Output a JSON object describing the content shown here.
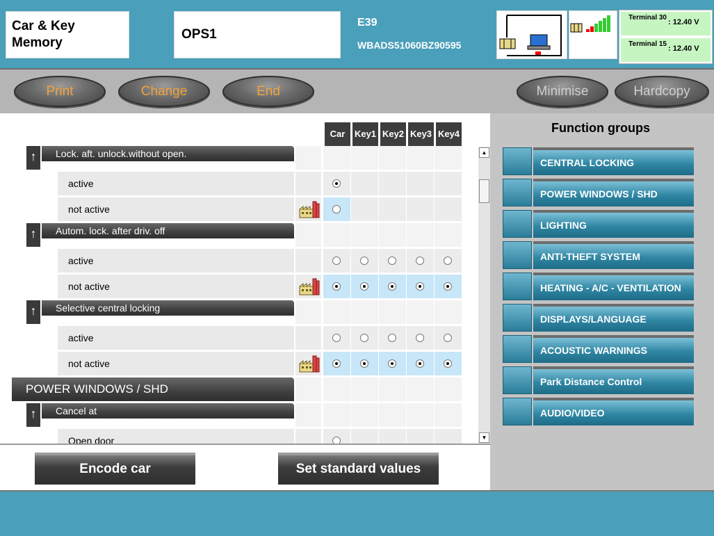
{
  "header": {
    "title": "Car & Key Memory",
    "job": "OPS1",
    "model": "E39",
    "vin": "WBADS51060BZ90595",
    "terminals": [
      {
        "label": "Terminal 30",
        "value": ": 12.40 V"
      },
      {
        "label": "Terminal 15",
        "value": ": 12.40 V"
      }
    ]
  },
  "toolbar": {
    "print": "Print",
    "change": "Change",
    "end": "End",
    "minimise": "Minimise",
    "hardcopy": "Hardcopy"
  },
  "grid": {
    "columns": [
      "Car",
      "Key1",
      "Key2",
      "Key3",
      "Key4"
    ],
    "rows": [
      {
        "type": "setting",
        "label": "Lock. aft. unlock.without open."
      },
      {
        "type": "option",
        "label": "active",
        "factory": false,
        "highlight": false,
        "radios": [
          true,
          null,
          null,
          null,
          null
        ]
      },
      {
        "type": "option",
        "label": "not active",
        "factory": true,
        "highlight": true,
        "radios": [
          false,
          null,
          null,
          null,
          null
        ]
      },
      {
        "type": "setting",
        "label": "Autom. lock. after driv. off"
      },
      {
        "type": "option",
        "label": "active",
        "factory": false,
        "highlight": false,
        "radios": [
          false,
          false,
          false,
          false,
          false
        ]
      },
      {
        "type": "option",
        "label": "not active",
        "factory": true,
        "highlight": true,
        "radios": [
          true,
          true,
          true,
          true,
          true
        ]
      },
      {
        "type": "setting",
        "label": "Selective central locking"
      },
      {
        "type": "option",
        "label": "active",
        "factory": false,
        "highlight": false,
        "radios": [
          false,
          false,
          false,
          false,
          false
        ]
      },
      {
        "type": "option",
        "label": "not active",
        "factory": true,
        "highlight": true,
        "radios": [
          true,
          true,
          true,
          true,
          true
        ]
      },
      {
        "type": "group",
        "label": "POWER WINDOWS / SHD"
      },
      {
        "type": "setting",
        "label": "Cancel at"
      },
      {
        "type": "option",
        "label": "Open door",
        "factory": false,
        "highlight": false,
        "radios": [
          false,
          null,
          null,
          null,
          null
        ]
      }
    ]
  },
  "function_groups": {
    "title": "Function groups",
    "items": [
      "CENTRAL LOCKING",
      "POWER WINDOWS / SHD",
      "LIGHTING",
      "ANTI-THEFT SYSTEM",
      "HEATING - A/C - VENTILATION",
      "DISPLAYS/LANGUAGE",
      "ACOUSTIC WARNINGS",
      "Park Distance Control",
      "AUDIO/VIDEO"
    ]
  },
  "actions": {
    "encode": "Encode car",
    "standard": "Set standard values"
  },
  "colors": {
    "header_bg": "#4a9fba",
    "accent_orange": "#f2a33a",
    "highlight_cell": "#c7e6f7",
    "terminal_green": "#c7f5c2"
  }
}
